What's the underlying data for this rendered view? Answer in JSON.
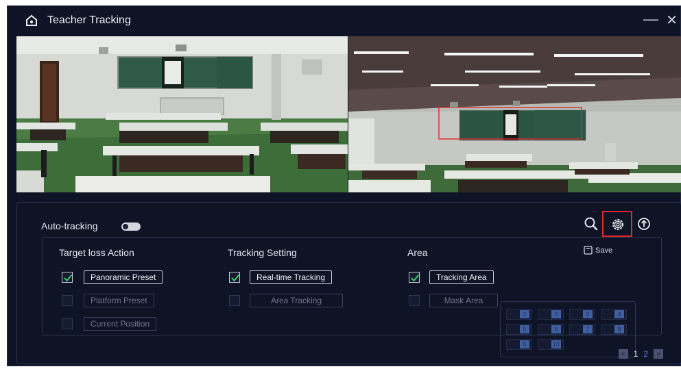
{
  "window": {
    "title": "Teacher Tracking",
    "minimize_glyph": "—",
    "close_glyph": "✕"
  },
  "auto_tracking": {
    "label": "Auto-tracking",
    "enabled": false
  },
  "toolbar": {
    "icons": [
      "search-icon",
      "gear-icon",
      "upload-icon"
    ]
  },
  "sections": {
    "target_loss": {
      "title": "Target loss Action",
      "options": [
        {
          "label": "Panoramic Preset",
          "checked": true
        },
        {
          "label": "Platform Preset",
          "checked": false
        },
        {
          "label": "Current Position",
          "checked": false
        }
      ]
    },
    "tracking_setting": {
      "title": "Tracking Setting",
      "options": [
        {
          "label": "Real-time Tracking",
          "checked": true
        },
        {
          "label": "Area Tracking",
          "checked": false
        }
      ]
    },
    "area": {
      "title": "Area",
      "save_label": "Save",
      "options": [
        {
          "label": "Tracking Area",
          "checked": true
        },
        {
          "label": "Mask Area",
          "checked": false
        }
      ],
      "cells": [
        "1",
        "2",
        "3",
        "4",
        "5",
        "6",
        "7",
        "8",
        "9",
        "10"
      ]
    }
  },
  "pager": {
    "prev_glyph": "<",
    "next_glyph": ">",
    "pages": [
      "1",
      "2"
    ],
    "active_page": "2"
  },
  "colors": {
    "background": "#0e1325",
    "accent": "#4a8bff",
    "check": "#3fd06a",
    "highlight": "#e02a2a",
    "board": "#2e5a47",
    "floor": "#3d6e3a"
  }
}
